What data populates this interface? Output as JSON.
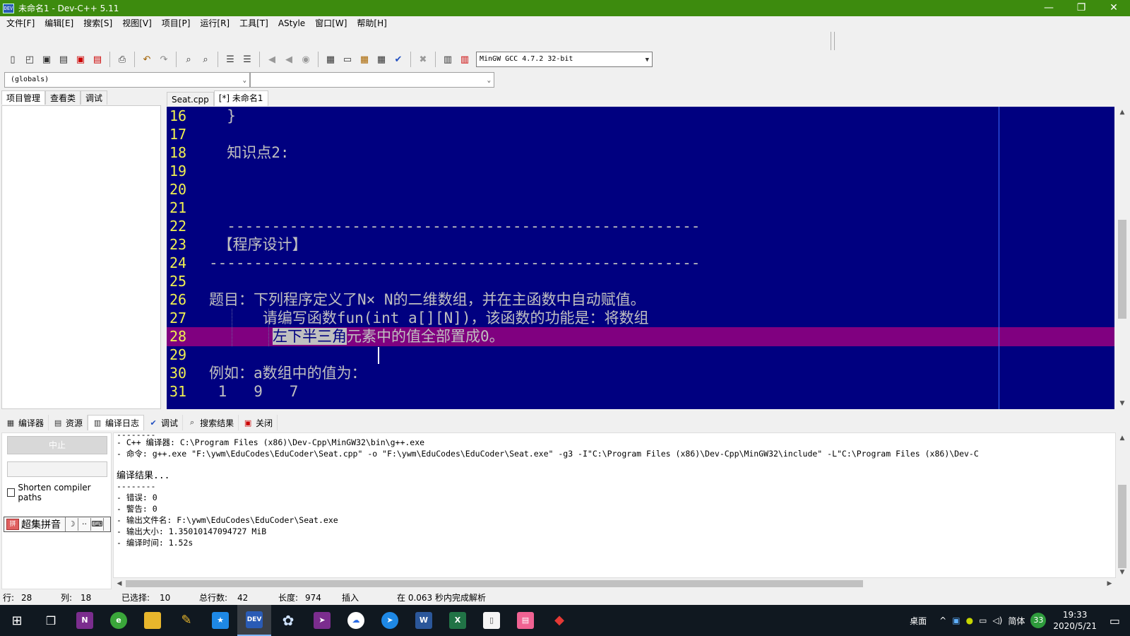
{
  "window": {
    "title": "未命名1 - Dev-C++ 5.11",
    "app_icon_text": "DEV",
    "buttons": {
      "minimize": "—",
      "restore": "❐",
      "close": "✕"
    }
  },
  "menu": [
    "文件[F]",
    "编辑[E]",
    "搜索[S]",
    "视图[V]",
    "项目[P]",
    "运行[R]",
    "工具[T]",
    "AStyle",
    "窗口[W]",
    "帮助[H]"
  ],
  "toolbar": {
    "compiler": "MinGW GCC 4.7.2 32-bit"
  },
  "scope": {
    "globals": "(globals)",
    "members": ""
  },
  "left_tabs": [
    "项目管理",
    "查看类",
    "调试"
  ],
  "editor_tabs": [
    "Seat.cpp",
    "[*] 未命名1"
  ],
  "editor": {
    "lines": [
      {
        "num": "16",
        "text": "  }"
      },
      {
        "num": "17",
        "text": ""
      },
      {
        "num": "18",
        "text": "  知识点2:"
      },
      {
        "num": "19",
        "text": ""
      },
      {
        "num": "20",
        "text": ""
      },
      {
        "num": "21",
        "text": ""
      },
      {
        "num": "22",
        "text": "  -----------------------------------------------------"
      },
      {
        "num": "23",
        "text": " 【程序设计】"
      },
      {
        "num": "24",
        "text": "-------------------------------------------------------"
      },
      {
        "num": "25",
        "text": ""
      },
      {
        "num": "26",
        "text": "题目：下列程序定义了N× N的二维数组，并在主函数中自动赋值。"
      },
      {
        "num": "27",
        "text": "      请编写函数fun(int a[][N])，该函数的功能是：将数组"
      },
      {
        "num": "28",
        "text_selected": "左下半三角",
        "text_rest": "元素中的值全部置成0。"
      },
      {
        "num": "29",
        "text": ""
      },
      {
        "num": "30",
        "text": "例如：a数组中的值为："
      },
      {
        "num": "31",
        "text": " 1   9   7"
      }
    ]
  },
  "bottom_tabs": [
    "编译器",
    "资源",
    "编译日志",
    "调试",
    "搜索结果",
    "关闭"
  ],
  "bottom_left": {
    "stop_label": "中止",
    "shorten_label": "Shorten compiler paths",
    "ime_label": "超集拼音"
  },
  "log": [
    "--------",
    "- C++ 编译器: C:\\Program Files (x86)\\Dev-Cpp\\MinGW32\\bin\\g++.exe",
    "- 命令: g++.exe \"F:\\ywm\\EduCodes\\EduCoder\\Seat.cpp\" -o \"F:\\ywm\\EduCodes\\EduCoder\\Seat.exe\" -g3 -I\"C:\\Program Files (x86)\\Dev-Cpp\\MinGW32\\include\" -L\"C:\\Program Files (x86)\\Dev-C",
    "",
    "编译结果...",
    "--------",
    "- 错误: 0",
    "- 警告: 0",
    "- 输出文件名: F:\\ywm\\EduCodes\\EduCoder\\Seat.exe",
    "- 输出大小: 1.35010147094727 MiB",
    "- 编译时间: 1.52s"
  ],
  "status": {
    "row_label": "行:",
    "row": "28",
    "col_label": "列:",
    "col": "18",
    "sel_label": "已选择:",
    "sel": "10",
    "lines_label": "总行数:",
    "lines": "42",
    "len_label": "长度:",
    "len": "974",
    "mode": "插入",
    "parse": "在 0.063 秒内完成解析"
  },
  "taskbar": {
    "desktop_label": "桌面",
    "lang": "简体",
    "badge": "33",
    "time": "19:33",
    "date": "2020/5/21"
  }
}
